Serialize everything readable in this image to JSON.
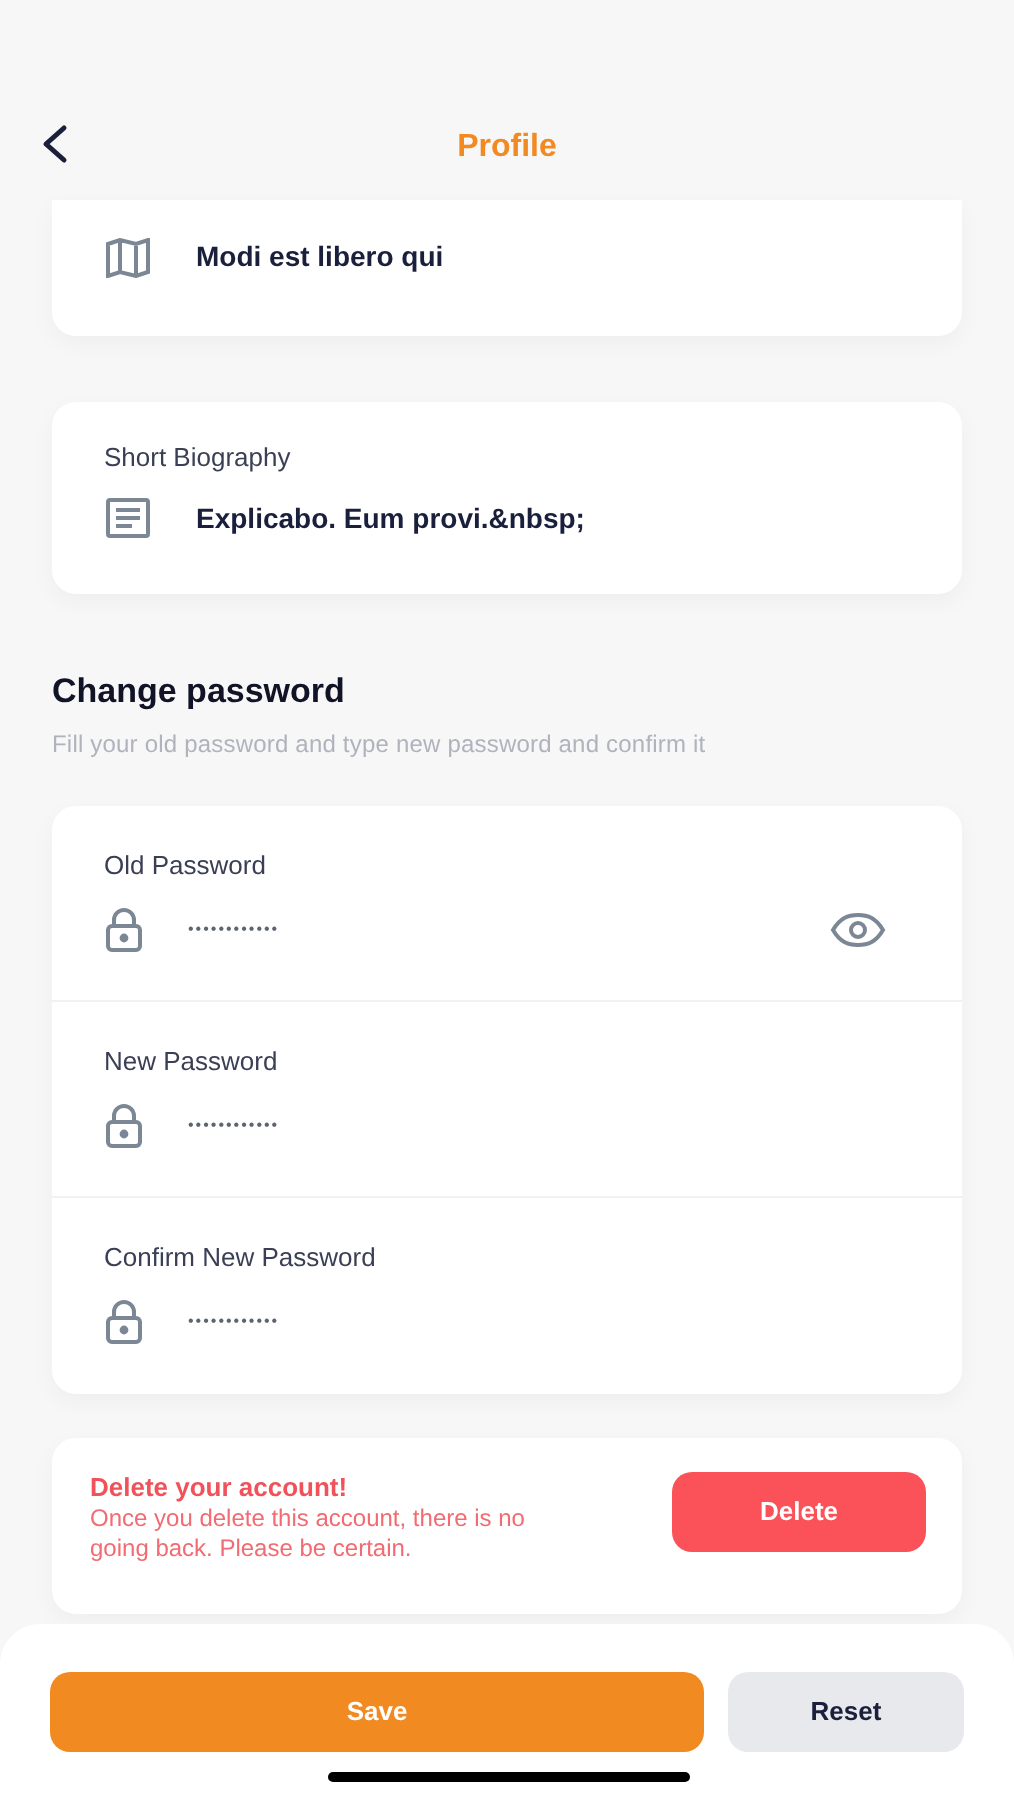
{
  "header": {
    "title": "Profile"
  },
  "profile_fields": [
    {
      "kind": "address",
      "value": "Modi est libero qui"
    },
    {
      "kind": "biography",
      "label": "Short Biography",
      "value": "Explicabo. Eum provi.&nbsp;"
    }
  ],
  "change_password": {
    "title": "Change password",
    "subtitle": "Fill your old password and type new password and confirm it",
    "fields": [
      {
        "label": "Old Password",
        "value": "••••••••••••",
        "reveal_toggle": true
      },
      {
        "label": "New Password",
        "value": "••••••••••••",
        "reveal_toggle": false
      },
      {
        "label": "Confirm New Password",
        "value": "••••••••••••",
        "reveal_toggle": false
      }
    ]
  },
  "delete_account": {
    "title": "Delete your account!",
    "message": "Once you delete this account, there is no going back. Please be certain.",
    "button": "Delete"
  },
  "actions": {
    "save": "Save",
    "reset": "Reset"
  }
}
